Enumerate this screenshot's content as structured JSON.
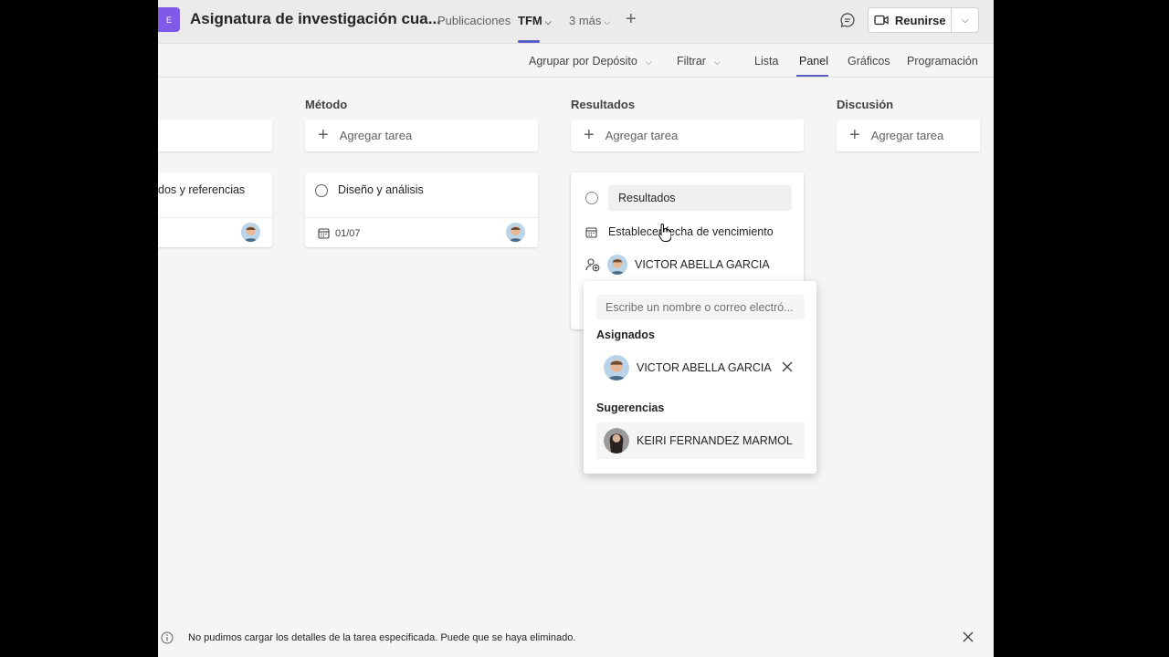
{
  "topbar": {
    "team_initial": "E",
    "channel_title": "Asignatura de investigación cua...",
    "tabs": [
      {
        "label": "Publicaciones",
        "active": false
      },
      {
        "label": "TFM",
        "active": true
      },
      {
        "label": "3 más",
        "active": false
      }
    ],
    "meet_label": "Reunirse"
  },
  "subbar": {
    "group_by": "Agrupar por Depósito",
    "filter": "Filtrar",
    "views": [
      "Lista",
      "Panel",
      "Gráficos",
      "Programación"
    ],
    "active_view": "Panel"
  },
  "board": {
    "add_task_label": "Agregar tarea",
    "columns": [
      {
        "title": "",
        "cards": [
          {
            "title": "dos y referencias"
          }
        ]
      },
      {
        "title": "Método",
        "cards": [
          {
            "title": "Diseño y análisis",
            "due": "01/07"
          }
        ]
      },
      {
        "title": "Resultados",
        "cards": []
      },
      {
        "title": "Discusión",
        "cards": []
      }
    ]
  },
  "editing_card": {
    "title_value": "Resultados",
    "due_date_label": "Establecer fecha de vencimiento",
    "assignee": "VICTOR ABELLA GARCIA"
  },
  "assign_popup": {
    "placeholder": "Escribe un nombre o correo electró...",
    "assigned_heading": "Asignados",
    "assigned": [
      "VICTOR ABELLA GARCIA"
    ],
    "suggestions_heading": "Sugerencias",
    "suggestions": [
      "KEIRI FERNANDEZ MARMOL"
    ]
  },
  "status": {
    "message": "No pudimos cargar los detalles de la tarea especificada. Puede que se haya eliminado."
  },
  "colors": {
    "accent": "#5b5fc7",
    "team_avatar": "#7f5ae8"
  }
}
